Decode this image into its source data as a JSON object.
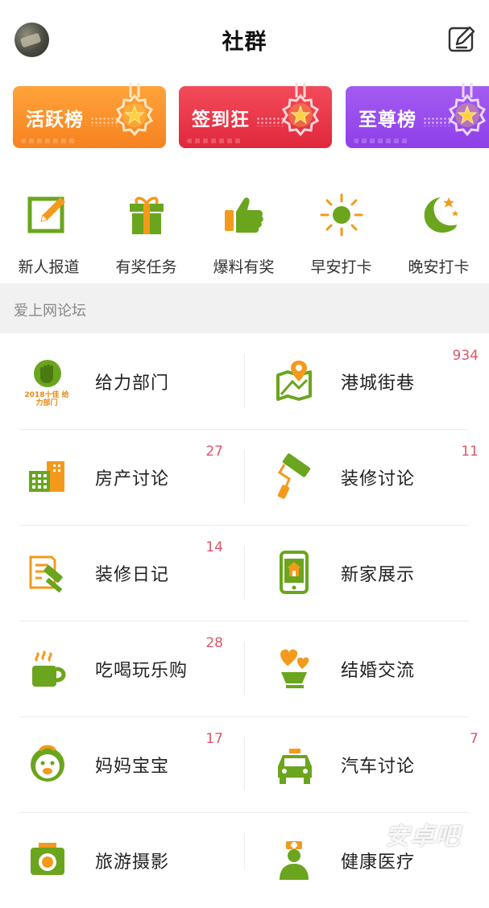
{
  "header": {
    "title": "社群"
  },
  "banners": [
    {
      "label": "活跃榜",
      "color_top": "#ffa33a",
      "color_bottom": "#f7821f"
    },
    {
      "label": "签到狂",
      "color_top": "#f24b5a",
      "color_bottom": "#e0283c"
    },
    {
      "label": "至尊榜",
      "color_top": "#a45cf2",
      "color_bottom": "#8e3fe8"
    }
  ],
  "quick_actions": [
    {
      "label": "新人报道",
      "icon": "edit-note-icon"
    },
    {
      "label": "有奖任务",
      "icon": "gift-icon"
    },
    {
      "label": "爆料有奖",
      "icon": "thumbs-up-icon"
    },
    {
      "label": "早安打卡",
      "icon": "sun-icon"
    },
    {
      "label": "晚安打卡",
      "icon": "moon-icon"
    }
  ],
  "section": {
    "title": "爱上网论坛"
  },
  "forums": [
    {
      "name": "给力部门",
      "count": "",
      "icon": "fist-badge-icon",
      "icon_text": "2018十佳 给力部门"
    },
    {
      "name": "港城街巷",
      "count": "934",
      "icon": "map-pin-icon"
    },
    {
      "name": "房产讨论",
      "count": "27",
      "icon": "buildings-icon"
    },
    {
      "name": "装修讨论",
      "count": "11",
      "icon": "paint-roller-icon"
    },
    {
      "name": "装修日记",
      "count": "14",
      "icon": "diary-hammer-icon"
    },
    {
      "name": "新家展示",
      "count": "",
      "icon": "phone-house-icon"
    },
    {
      "name": "吃喝玩乐购",
      "count": "28",
      "icon": "coffee-cup-icon"
    },
    {
      "name": "结婚交流",
      "count": "",
      "icon": "hearts-cup-icon"
    },
    {
      "name": "妈妈宝宝",
      "count": "17",
      "icon": "baby-face-icon"
    },
    {
      "name": "汽车讨论",
      "count": "7",
      "icon": "taxi-icon"
    },
    {
      "name": "旅游摄影",
      "count": "",
      "icon": "camera-icon"
    },
    {
      "name": "健康医疗",
      "count": "",
      "icon": "doctor-icon"
    }
  ],
  "watermark": "安卓吧",
  "colors": {
    "green": "#6aa51d",
    "orange": "#f39a1c",
    "badge_red": "#e0556a"
  }
}
